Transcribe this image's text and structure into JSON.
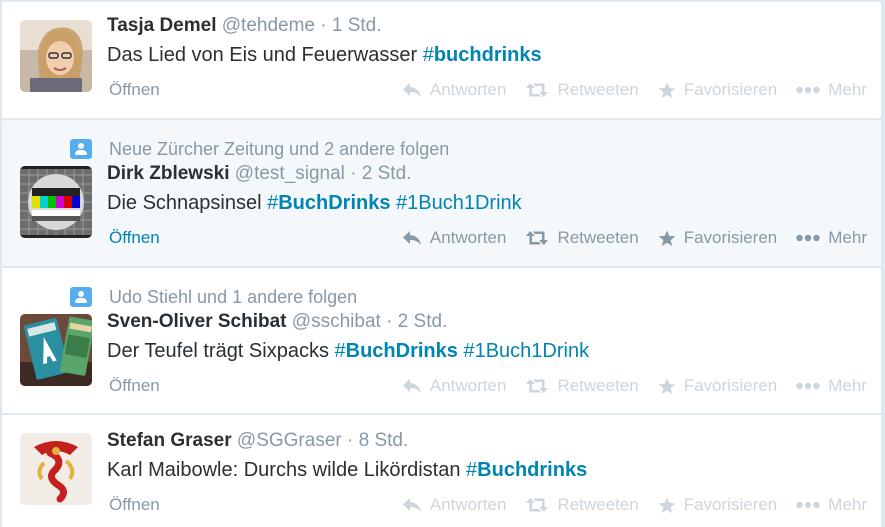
{
  "tweets": [
    {
      "context": "",
      "fullname": "Tasja Demel",
      "username": "@tehdeme",
      "time": "· 1 Std.",
      "text_before": "Das Lied von Eis und Feuerwasser ",
      "hashtags": [
        {
          "hash": "#",
          "tag": "buchdrinks"
        }
      ],
      "open_label": "Öffnen"
    },
    {
      "context": "Neue Zürcher Zeitung und 2 andere folgen",
      "fullname": "Dirk Zblewski",
      "username": "@test_signal",
      "time": "· 2 Std.",
      "text_before": "Die Schnapsinsel ",
      "hashtags": [
        {
          "hash": "#",
          "tag": "BuchDrinks"
        },
        {
          "hash": "#",
          "tag": "1Buch1Drink"
        }
      ],
      "open_label": "Öffnen"
    },
    {
      "context": "Udo Stiehl und 1 andere folgen",
      "fullname": "Sven-Oliver Schibat",
      "username": "@sschibat",
      "time": "· 2 Std.",
      "text_before": "Der Teufel trägt Sixpacks ",
      "hashtags": [
        {
          "hash": "#",
          "tag": "BuchDrinks"
        },
        {
          "hash": "#",
          "tag": "1Buch1Drink"
        }
      ],
      "open_label": "Öffnen"
    },
    {
      "context": "",
      "fullname": "Stefan Graser",
      "username": "@SGGraser",
      "time": "· 8 Std.",
      "text_before": "Karl Maibowle: Durchs wilde Likördistan ",
      "hashtags": [
        {
          "hash": "#",
          "tag": "Buchdrinks"
        }
      ],
      "open_label": "Öffnen"
    }
  ],
  "actions": {
    "reply": "Antworten",
    "retweet": "Retweeten",
    "favorite": "Favorisieren",
    "more": "Mehr"
  },
  "icons": {
    "context": "person-follow-icon",
    "reply": "reply-arrow-icon",
    "retweet": "retweet-icon",
    "favorite": "star-icon",
    "more": "more-dots-icon"
  },
  "colors": {
    "hashtag": "#0084b4",
    "muted": "#8899a6",
    "faded_action": "#ccd6dd",
    "highlight_bg": "#f5f8fa",
    "context_icon": "#55acee"
  }
}
